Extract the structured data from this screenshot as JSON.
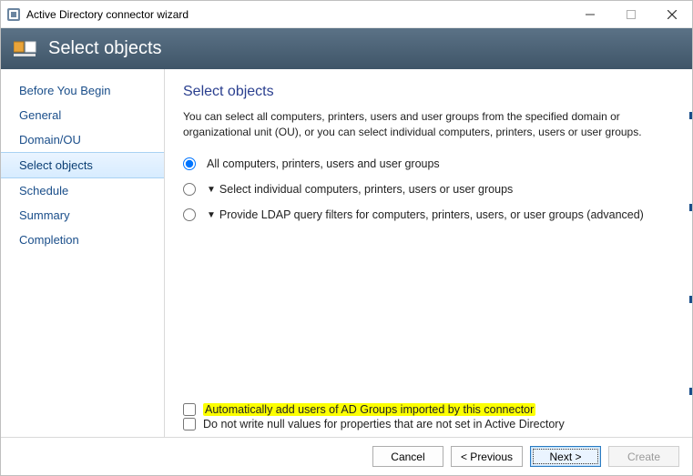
{
  "window": {
    "title": "Active Directory connector wizard"
  },
  "banner": {
    "title": "Select objects"
  },
  "sidebar": {
    "items": [
      {
        "label": "Before You Begin",
        "selected": false
      },
      {
        "label": "General",
        "selected": false
      },
      {
        "label": "Domain/OU",
        "selected": false
      },
      {
        "label": "Select objects",
        "selected": true
      },
      {
        "label": "Schedule",
        "selected": false
      },
      {
        "label": "Summary",
        "selected": false
      },
      {
        "label": "Completion",
        "selected": false
      }
    ]
  },
  "content": {
    "title": "Select objects",
    "description": "You can select all computers, printers, users and user groups from the specified domain or organizational unit (OU), or you can select individual computers, printers, users or user groups.",
    "radios": [
      {
        "label": "All computers, printers, users and user groups",
        "expandable": false,
        "checked": true
      },
      {
        "label": "Select individual computers, printers, users or user groups",
        "expandable": true,
        "checked": false
      },
      {
        "label": "Provide LDAP query filters for computers, printers, users, or user groups (advanced)",
        "expandable": true,
        "checked": false
      }
    ],
    "checks": [
      {
        "label": "Automatically add users of AD Groups imported by this connector",
        "highlight": true,
        "checked": false
      },
      {
        "label": "Do not write null values for properties that are not set in Active Directory",
        "highlight": false,
        "checked": false
      }
    ]
  },
  "footer": {
    "cancel": "Cancel",
    "previous": "< Previous",
    "next": "Next >",
    "create": "Create"
  }
}
